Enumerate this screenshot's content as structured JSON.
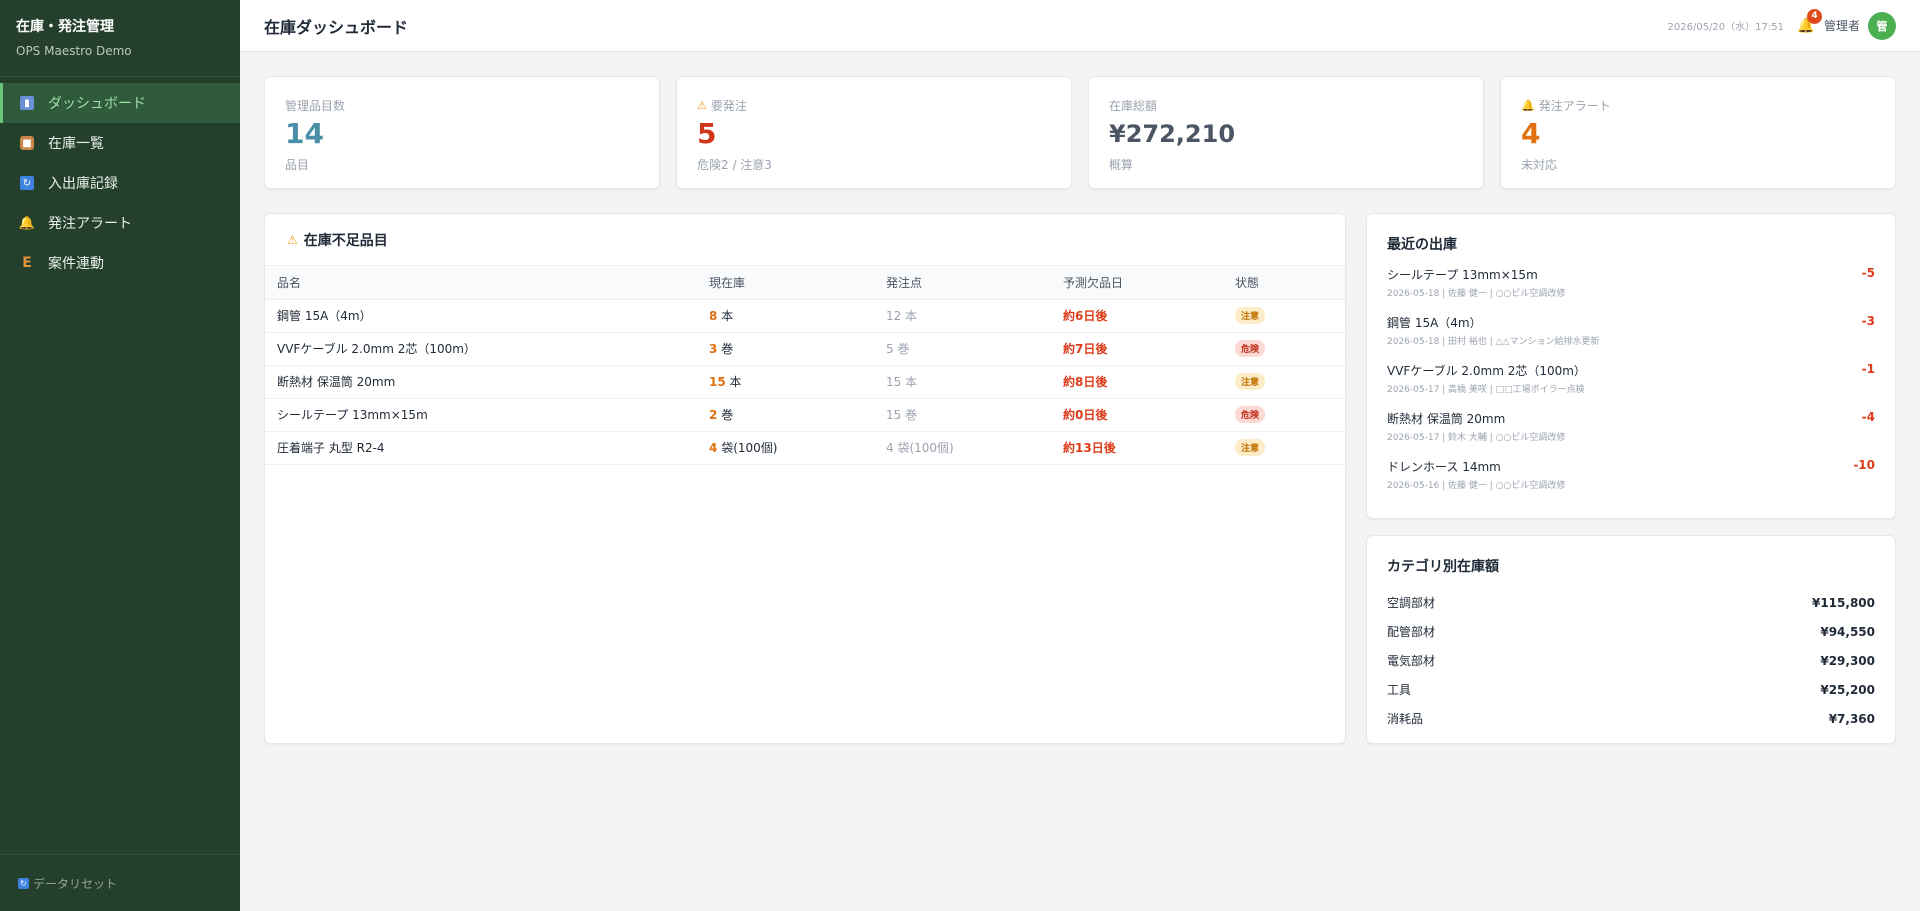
{
  "sidebar": {
    "title": "在庫・発注管理",
    "subtitle": "OPS Maestro Demo",
    "items": [
      {
        "label": "ダッシュボード",
        "icon": "bar-chart-icon"
      },
      {
        "label": "在庫一覧",
        "icon": "package-icon"
      },
      {
        "label": "入出庫記録",
        "icon": "refresh-icon"
      },
      {
        "label": "発注アラート",
        "icon": "bell-icon"
      },
      {
        "label": "案件連動",
        "icon": "e-letter-icon"
      }
    ],
    "reset_label": "データリセット"
  },
  "header": {
    "title": "在庫ダッシュボード",
    "datetime": "2026/05/20（水）17:51",
    "notification_count": "4",
    "user": "管理者",
    "avatar_initial": "管"
  },
  "stats": [
    {
      "label": "管理品目数",
      "value": "14",
      "sub": "品目",
      "color": "#4a8fa8"
    },
    {
      "label": "要発注",
      "value": "5",
      "sub": "危険2 / 注意3",
      "color": "#d0361a"
    },
    {
      "label": "在庫総額",
      "value": "¥272,210",
      "sub": "概算",
      "color": "#4b5563"
    },
    {
      "label": "発注アラート",
      "value": "4",
      "sub": "未対応",
      "color": "#e07010"
    }
  ],
  "lowstock": {
    "title": "在庫不足品目",
    "columns": [
      "品名",
      "現在庫",
      "発注点",
      "予測欠品日",
      "状態"
    ],
    "rows": [
      {
        "name": "鋼管 15A（4m）",
        "qty": "8",
        "unit": "本",
        "reorder": "12 本",
        "eta": "約6日後",
        "status": "注意",
        "level": "caution"
      },
      {
        "name": "VVFケーブル 2.0mm 2芯（100m）",
        "qty": "3",
        "unit": "巻",
        "reorder": "5 巻",
        "eta": "約7日後",
        "status": "危険",
        "level": "danger"
      },
      {
        "name": "断熱材 保温筒 20mm",
        "qty": "15",
        "unit": "本",
        "reorder": "15 本",
        "eta": "約8日後",
        "status": "注意",
        "level": "caution"
      },
      {
        "name": "シールテープ 13mm×15m",
        "qty": "2",
        "unit": "巻",
        "reorder": "15 巻",
        "eta": "約0日後",
        "status": "危険",
        "level": "danger"
      },
      {
        "name": "圧着端子 丸型 R2-4",
        "qty": "4",
        "unit": "袋(100個)",
        "reorder": "4 袋(100個)",
        "eta": "約13日後",
        "status": "注意",
        "level": "caution"
      }
    ]
  },
  "recent": {
    "title": "最近の出庫",
    "items": [
      {
        "name": "シールテープ 13mm×15m",
        "meta": "2026-05-18 | 佐藤 健一 | ○○ビル空調改修",
        "qty": "-5"
      },
      {
        "name": "鋼管 15A（4m）",
        "meta": "2026-05-18 | 田村 裕也 | △△マンション給排水更新",
        "qty": "-3"
      },
      {
        "name": "VVFケーブル 2.0mm 2芯（100m）",
        "meta": "2026-05-17 | 高橋 美咲 | □□工場ボイラー点検",
        "qty": "-1"
      },
      {
        "name": "断熱材 保温筒 20mm",
        "meta": "2026-05-17 | 鈴木 大輔 | ○○ビル空調改修",
        "qty": "-4"
      },
      {
        "name": "ドレンホース 14mm",
        "meta": "2026-05-16 | 佐藤 健一 | ○○ビル空調改修",
        "qty": "-10"
      }
    ]
  },
  "categories": {
    "title": "カテゴリ別在庫額",
    "items": [
      {
        "name": "空調部材",
        "value": "¥115,800"
      },
      {
        "name": "配管部材",
        "value": "¥94,550"
      },
      {
        "name": "電気部材",
        "value": "¥29,300"
      },
      {
        "name": "工具",
        "value": "¥25,200"
      },
      {
        "name": "消耗品",
        "value": "¥7,360"
      }
    ]
  },
  "colors": {
    "sidebar_bg": "#24402d",
    "active_accent": "#6cc47a",
    "danger": "#dc3c1a",
    "warning": "#e07010"
  }
}
